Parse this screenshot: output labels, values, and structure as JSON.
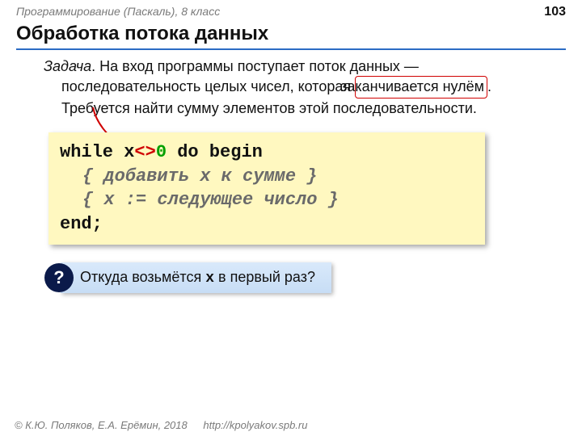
{
  "header": {
    "course": "Программирование (Паскаль), 8 класс",
    "page": "103"
  },
  "title": "Обработка потока данных",
  "task": {
    "lead": "Задача",
    "before": ". На вход программы поступает поток данных — последовательность целых чисел, которая ",
    "highlight": "заканчивается нулём",
    "after": ". Требуется найти сумму элементов этой последовательности."
  },
  "code": {
    "l1a": "while x",
    "l1op": "<>",
    "l1num": "0",
    "l1b": " do begin",
    "l2": "{ добавить x к сумме }",
    "l3": "{ x := следующее число }",
    "l4": "end;"
  },
  "question": {
    "mark": "?",
    "pre": "Откуда возьмётся ",
    "var": "x",
    "post": " в первый раз?"
  },
  "footer": {
    "copyright": "© К.Ю. Поляков, Е.А. Ерёмин, 2018",
    "url": "http://kpolyakov.spb.ru"
  }
}
